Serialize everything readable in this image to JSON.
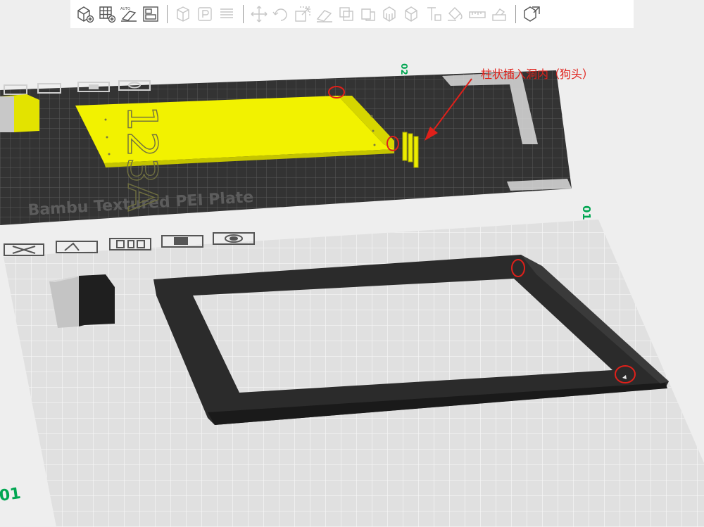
{
  "toolbar": {
    "buttons": [
      {
        "name": "add-object-button",
        "icon": "cube-plus-icon",
        "enabled": true,
        "group": 0
      },
      {
        "name": "add-plate-button",
        "icon": "grid-plus-icon",
        "enabled": true,
        "group": 0
      },
      {
        "name": "auto-orient-button",
        "icon": "auto-orient-icon",
        "enabled": true,
        "group": 0,
        "label": "AUTO"
      },
      {
        "name": "arrange-button",
        "icon": "arrange-icon",
        "enabled": true,
        "group": 0
      },
      {
        "name": "lay-on-face-button",
        "icon": "cube-outline-icon",
        "enabled": false,
        "group": 1
      },
      {
        "name": "placement-button",
        "icon": "p-box-icon",
        "enabled": false,
        "group": 1
      },
      {
        "name": "split-button",
        "icon": "lines-icon",
        "enabled": false,
        "group": 1
      },
      {
        "name": "move-button",
        "icon": "move-arrows-icon",
        "enabled": false,
        "group": 2
      },
      {
        "name": "rotate-button",
        "icon": "rotate-icon",
        "enabled": false,
        "group": 2
      },
      {
        "name": "scale-button",
        "icon": "scale-icon",
        "enabled": false,
        "group": 2
      },
      {
        "name": "place-face-button",
        "icon": "place-face-icon",
        "enabled": false,
        "group": 2
      },
      {
        "name": "cut-button",
        "icon": "cut-icon",
        "enabled": false,
        "group": 2
      },
      {
        "name": "boolean-button",
        "icon": "boolean-icon",
        "enabled": false,
        "group": 2
      },
      {
        "name": "support-paint-button",
        "icon": "support-paint-icon",
        "enabled": false,
        "group": 2
      },
      {
        "name": "seam-paint-button",
        "icon": "seam-paint-icon",
        "enabled": false,
        "group": 2
      },
      {
        "name": "text-button",
        "icon": "text-shape-icon",
        "enabled": false,
        "group": 2
      },
      {
        "name": "color-paint-button",
        "icon": "paint-bucket-icon",
        "enabled": false,
        "group": 2
      },
      {
        "name": "measure-button",
        "icon": "ruler-icon",
        "enabled": false,
        "group": 2
      },
      {
        "name": "assembly-button",
        "icon": "assembly-icon",
        "enabled": false,
        "group": 2
      },
      {
        "name": "explode-button",
        "icon": "explode-icon",
        "enabled": true,
        "group": 3
      }
    ]
  },
  "plate1": {
    "number": "02",
    "label": "Bambu Textured PEI Plate",
    "part_text": "123A",
    "colors": {
      "bed": "#333333",
      "bed_grid": "#5a5a5a",
      "part": "#f2f200",
      "part_dark": "#c4c400",
      "edge": "#dcdcdc"
    }
  },
  "plate2": {
    "number": "01",
    "colors": {
      "bed": "#e0e0e0",
      "bed_grid": "#f7f7f7",
      "frame": "#2b2b2b",
      "frame_side": "#1a1a1a",
      "block_light": "#bebebe",
      "block_dark": "#1f1f1f"
    }
  },
  "plate3": {
    "number": "01"
  },
  "annotation": {
    "text": "柱状插入洞内（狗头）",
    "color": "#e0201a"
  },
  "plate_icons": [
    "close-plate-icon",
    "auto-orient-plate-icon",
    "arrange-plate-icon",
    "lock-plate-icon",
    "plate-settings-icon"
  ]
}
